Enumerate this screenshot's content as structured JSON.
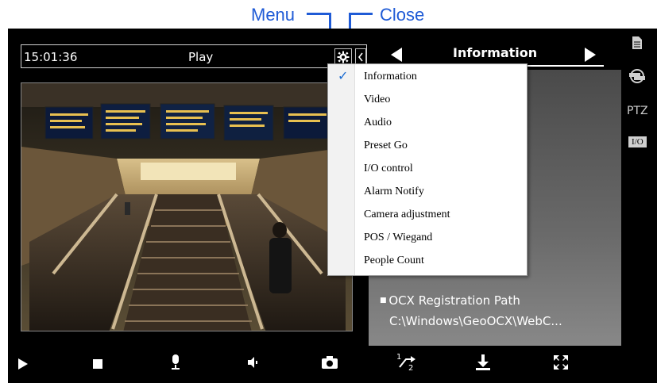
{
  "callouts": {
    "menu": "Menu",
    "close": "Close"
  },
  "topbar": {
    "time": "15:01:36",
    "mode": "Play"
  },
  "info_panel": {
    "title": "Information",
    "ocx_label": "OCX Registration Path",
    "ocx_path": "C:\\Windows\\GeoOCX\\WebC..."
  },
  "menu": {
    "items": [
      {
        "label": "Information",
        "checked": true
      },
      {
        "label": "Video"
      },
      {
        "label": "Audio"
      },
      {
        "label": "Preset Go"
      },
      {
        "label": "I/O control"
      },
      {
        "label": "Alarm Notify"
      },
      {
        "label": "Camera adjustment"
      },
      {
        "label": "POS / Wiegand"
      },
      {
        "label": "People Count"
      }
    ]
  },
  "sidebar": {
    "ptz_label": "PTZ",
    "io_label": "I/O"
  },
  "controls": {
    "icons": [
      "play-icon",
      "stop-icon",
      "microphone-icon",
      "speaker-icon",
      "snapshot-icon",
      "half-speed-icon",
      "download-icon",
      "fullscreen-icon"
    ],
    "half_speed_label": "1/2"
  },
  "colors": {
    "callout": "#1f5bd6",
    "check": "#1a6bd1",
    "background": "#000000"
  }
}
